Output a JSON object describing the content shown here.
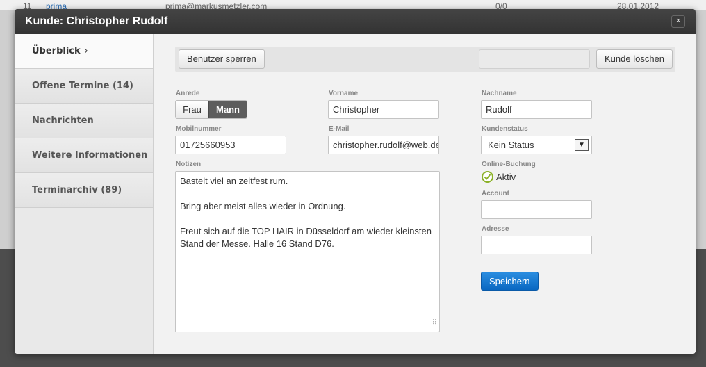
{
  "background": {
    "row_number": "11",
    "row_name": "prima",
    "row_email": "prima@markusmetzler.com",
    "row_count": "0/0",
    "row_date": "28.01.2012"
  },
  "dialog": {
    "title": "Kunde: Christopher Rudolf",
    "close_label": "×"
  },
  "sidebar": {
    "items": [
      {
        "label": "Überblick",
        "chevron": "›"
      },
      {
        "label": "Offene Termine (14)"
      },
      {
        "label": "Nachrichten"
      },
      {
        "label": "Weitere Informationen"
      },
      {
        "label": "Terminarchiv (89)"
      }
    ]
  },
  "toolbar": {
    "block_user_label": "Benutzer sperren",
    "delete_customer_label": "Kunde löschen"
  },
  "form": {
    "anrede": {
      "label": "Anrede",
      "options": [
        "Frau",
        "Mann"
      ],
      "selected": "Mann"
    },
    "vorname": {
      "label": "Vorname",
      "value": "Christopher"
    },
    "nachname": {
      "label": "Nachname",
      "value": "Rudolf"
    },
    "mobilnummer": {
      "label": "Mobilnummer",
      "value": "01725660953"
    },
    "email": {
      "label": "E-Mail",
      "value": "christopher.rudolf@web.de"
    },
    "kundenstatus": {
      "label": "Kundenstatus",
      "value": "Kein Status"
    },
    "notizen": {
      "label": "Notizen",
      "lines": [
        "Bastelt viel an zeitfest rum.",
        "Bring aber meist alles wieder in Ordnung.",
        "Freut sich auf die TOP HAIR in Düsseldorf am wieder kleinsten Stand der Messe. Halle 16 Stand D76."
      ]
    },
    "online_buchung": {
      "label": "Online-Buchung",
      "value": "Aktiv"
    },
    "account": {
      "label": "Account",
      "value": ""
    },
    "adresse": {
      "label": "Adresse",
      "value": ""
    },
    "save_label": "Speichern"
  },
  "colors": {
    "save_button": "#0a68c2",
    "active_toggle": "#5d5d5d",
    "check": "#8bb128",
    "titlebar": "#333333"
  }
}
